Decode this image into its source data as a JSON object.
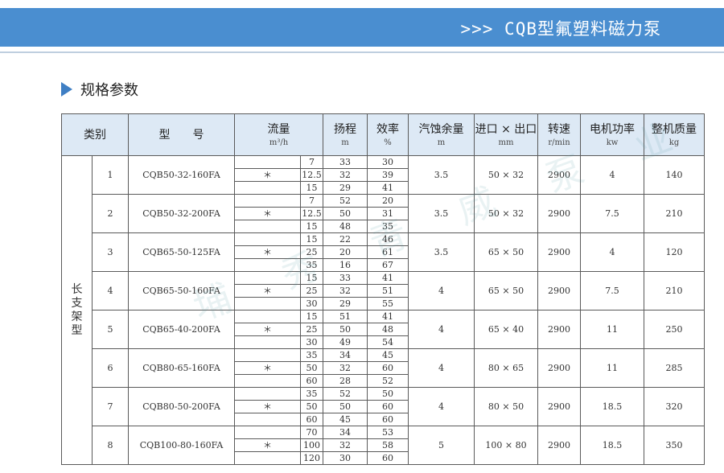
{
  "banner": {
    "title": ">>> CQB型氟塑料磁力泵",
    "color": "#4a8ed0"
  },
  "section": {
    "title": "规格参数",
    "icon": "triangle-right-icon",
    "icon_color": "#3f7fc4"
  },
  "table": {
    "headers": [
      {
        "label": "类别",
        "unit": ""
      },
      {
        "label": "型　　号",
        "unit": ""
      },
      {
        "label": "流量",
        "unit": "m³/h"
      },
      {
        "label": "扬程",
        "unit": "m"
      },
      {
        "label": "效率",
        "unit": "%"
      },
      {
        "label": "汽蚀余量",
        "unit": "m"
      },
      {
        "label": "进口 × 出口",
        "unit": "mm"
      },
      {
        "label": "转速",
        "unit": "r/min"
      },
      {
        "label": "电机功率",
        "unit": "kw"
      },
      {
        "label": "整机质量",
        "unit": "kg"
      }
    ],
    "group": "长支架型",
    "header_bg": "#dde9f5",
    "rows": [
      {
        "no": "1",
        "model": "CQB50-32-160FA",
        "npsh": "3.5",
        "inout": "50 × 32",
        "speed": "2900",
        "power": "4",
        "mass": "140",
        "points": [
          {
            "flow": "7",
            "head": "33",
            "eff": "30",
            "star": ""
          },
          {
            "flow": "12.5",
            "head": "32",
            "eff": "39",
            "star": "＊"
          },
          {
            "flow": "15",
            "head": "29",
            "eff": "41",
            "star": ""
          }
        ]
      },
      {
        "no": "2",
        "model": "CQB50-32-200FA",
        "npsh": "3.5",
        "inout": "50 × 32",
        "speed": "2900",
        "power": "7.5",
        "mass": "210",
        "points": [
          {
            "flow": "7",
            "head": "52",
            "eff": "20",
            "star": ""
          },
          {
            "flow": "12.5",
            "head": "50",
            "eff": "31",
            "star": "＊"
          },
          {
            "flow": "15",
            "head": "48",
            "eff": "35",
            "star": ""
          }
        ]
      },
      {
        "no": "3",
        "model": "CQB65-50-125FA",
        "npsh": "3.5",
        "inout": "65 × 50",
        "speed": "2900",
        "power": "4",
        "mass": "120",
        "points": [
          {
            "flow": "15",
            "head": "22",
            "eff": "46",
            "star": ""
          },
          {
            "flow": "25",
            "head": "20",
            "eff": "61",
            "star": "＊"
          },
          {
            "flow": "35",
            "head": "16",
            "eff": "67",
            "star": ""
          }
        ]
      },
      {
        "no": "4",
        "model": "CQB65-50-160FA",
        "npsh": "4",
        "inout": "65 × 50",
        "speed": "2900",
        "power": "7.5",
        "mass": "210",
        "points": [
          {
            "flow": "15",
            "head": "33",
            "eff": "41",
            "star": ""
          },
          {
            "flow": "25",
            "head": "32",
            "eff": "51",
            "star": "＊"
          },
          {
            "flow": "30",
            "head": "29",
            "eff": "55",
            "star": ""
          }
        ]
      },
      {
        "no": "5",
        "model": "CQB65-40-200FA",
        "npsh": "4",
        "inout": "65 × 40",
        "speed": "2900",
        "power": "11",
        "mass": "250",
        "points": [
          {
            "flow": "15",
            "head": "51",
            "eff": "41",
            "star": ""
          },
          {
            "flow": "25",
            "head": "50",
            "eff": "48",
            "star": "＊"
          },
          {
            "flow": "30",
            "head": "49",
            "eff": "54",
            "star": ""
          }
        ]
      },
      {
        "no": "6",
        "model": "CQB80-65-160FA",
        "npsh": "4",
        "inout": "80 × 65",
        "speed": "2900",
        "power": "11",
        "mass": "285",
        "points": [
          {
            "flow": "35",
            "head": "34",
            "eff": "45",
            "star": ""
          },
          {
            "flow": "50",
            "head": "32",
            "eff": "60",
            "star": "＊"
          },
          {
            "flow": "60",
            "head": "28",
            "eff": "52",
            "star": ""
          }
        ]
      },
      {
        "no": "7",
        "model": "CQB80-50-200FA",
        "npsh": "4",
        "inout": "80 × 50",
        "speed": "2900",
        "power": "18.5",
        "mass": "320",
        "points": [
          {
            "flow": "35",
            "head": "52",
            "eff": "50",
            "star": ""
          },
          {
            "flow": "50",
            "head": "50",
            "eff": "60",
            "star": "＊"
          },
          {
            "flow": "60",
            "head": "45",
            "eff": "60",
            "star": ""
          }
        ]
      },
      {
        "no": "8",
        "model": "CQB100-80-160FA",
        "npsh": "5",
        "inout": "100 × 80",
        "speed": "2900",
        "power": "18.5",
        "mass": "350",
        "points": [
          {
            "flow": "70",
            "head": "34",
            "eff": "53",
            "star": ""
          },
          {
            "flow": "100",
            "head": "32",
            "eff": "58",
            "star": "＊"
          },
          {
            "flow": "120",
            "head": "30",
            "eff": "60",
            "star": ""
          }
        ]
      }
    ]
  },
  "watermark": "埔 秀 青 威 泵 业"
}
